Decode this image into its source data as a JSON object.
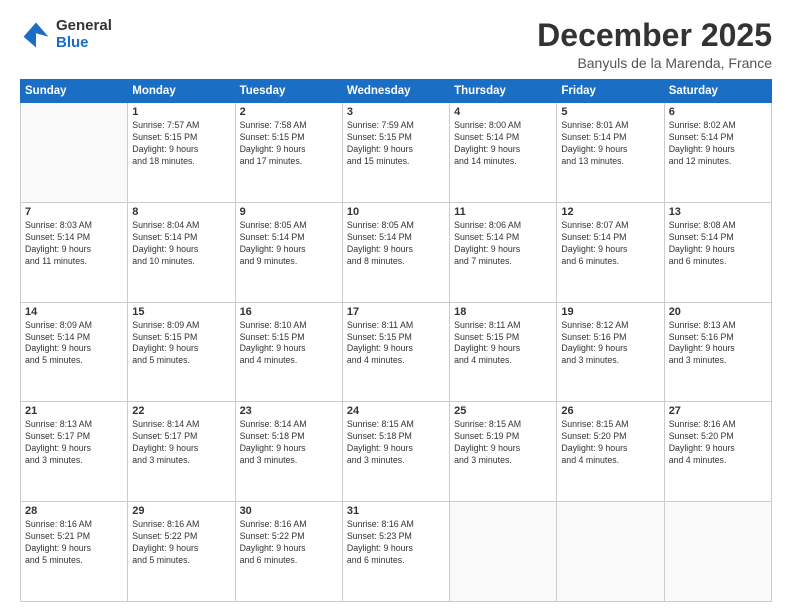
{
  "logo": {
    "general": "General",
    "blue": "Blue"
  },
  "header": {
    "month": "December 2025",
    "location": "Banyuls de la Marenda, France"
  },
  "days_of_week": [
    "Sunday",
    "Monday",
    "Tuesday",
    "Wednesday",
    "Thursday",
    "Friday",
    "Saturday"
  ],
  "weeks": [
    [
      {
        "day": "",
        "sunrise": "",
        "sunset": "",
        "daylight": ""
      },
      {
        "day": "1",
        "sunrise": "Sunrise: 7:57 AM",
        "sunset": "Sunset: 5:15 PM",
        "daylight": "Daylight: 9 hours and 18 minutes."
      },
      {
        "day": "2",
        "sunrise": "Sunrise: 7:58 AM",
        "sunset": "Sunset: 5:15 PM",
        "daylight": "Daylight: 9 hours and 17 minutes."
      },
      {
        "day": "3",
        "sunrise": "Sunrise: 7:59 AM",
        "sunset": "Sunset: 5:15 PM",
        "daylight": "Daylight: 9 hours and 15 minutes."
      },
      {
        "day": "4",
        "sunrise": "Sunrise: 8:00 AM",
        "sunset": "Sunset: 5:14 PM",
        "daylight": "Daylight: 9 hours and 14 minutes."
      },
      {
        "day": "5",
        "sunrise": "Sunrise: 8:01 AM",
        "sunset": "Sunset: 5:14 PM",
        "daylight": "Daylight: 9 hours and 13 minutes."
      },
      {
        "day": "6",
        "sunrise": "Sunrise: 8:02 AM",
        "sunset": "Sunset: 5:14 PM",
        "daylight": "Daylight: 9 hours and 12 minutes."
      }
    ],
    [
      {
        "day": "7",
        "sunrise": "Sunrise: 8:03 AM",
        "sunset": "Sunset: 5:14 PM",
        "daylight": "Daylight: 9 hours and 11 minutes."
      },
      {
        "day": "8",
        "sunrise": "Sunrise: 8:04 AM",
        "sunset": "Sunset: 5:14 PM",
        "daylight": "Daylight: 9 hours and 10 minutes."
      },
      {
        "day": "9",
        "sunrise": "Sunrise: 8:05 AM",
        "sunset": "Sunset: 5:14 PM",
        "daylight": "Daylight: 9 hours and 9 minutes."
      },
      {
        "day": "10",
        "sunrise": "Sunrise: 8:05 AM",
        "sunset": "Sunset: 5:14 PM",
        "daylight": "Daylight: 9 hours and 8 minutes."
      },
      {
        "day": "11",
        "sunrise": "Sunrise: 8:06 AM",
        "sunset": "Sunset: 5:14 PM",
        "daylight": "Daylight: 9 hours and 7 minutes."
      },
      {
        "day": "12",
        "sunrise": "Sunrise: 8:07 AM",
        "sunset": "Sunset: 5:14 PM",
        "daylight": "Daylight: 9 hours and 6 minutes."
      },
      {
        "day": "13",
        "sunrise": "Sunrise: 8:08 AM",
        "sunset": "Sunset: 5:14 PM",
        "daylight": "Daylight: 9 hours and 6 minutes."
      }
    ],
    [
      {
        "day": "14",
        "sunrise": "Sunrise: 8:09 AM",
        "sunset": "Sunset: 5:14 PM",
        "daylight": "Daylight: 9 hours and 5 minutes."
      },
      {
        "day": "15",
        "sunrise": "Sunrise: 8:09 AM",
        "sunset": "Sunset: 5:15 PM",
        "daylight": "Daylight: 9 hours and 5 minutes."
      },
      {
        "day": "16",
        "sunrise": "Sunrise: 8:10 AM",
        "sunset": "Sunset: 5:15 PM",
        "daylight": "Daylight: 9 hours and 4 minutes."
      },
      {
        "day": "17",
        "sunrise": "Sunrise: 8:11 AM",
        "sunset": "Sunset: 5:15 PM",
        "daylight": "Daylight: 9 hours and 4 minutes."
      },
      {
        "day": "18",
        "sunrise": "Sunrise: 8:11 AM",
        "sunset": "Sunset: 5:15 PM",
        "daylight": "Daylight: 9 hours and 4 minutes."
      },
      {
        "day": "19",
        "sunrise": "Sunrise: 8:12 AM",
        "sunset": "Sunset: 5:16 PM",
        "daylight": "Daylight: 9 hours and 3 minutes."
      },
      {
        "day": "20",
        "sunrise": "Sunrise: 8:13 AM",
        "sunset": "Sunset: 5:16 PM",
        "daylight": "Daylight: 9 hours and 3 minutes."
      }
    ],
    [
      {
        "day": "21",
        "sunrise": "Sunrise: 8:13 AM",
        "sunset": "Sunset: 5:17 PM",
        "daylight": "Daylight: 9 hours and 3 minutes."
      },
      {
        "day": "22",
        "sunrise": "Sunrise: 8:14 AM",
        "sunset": "Sunset: 5:17 PM",
        "daylight": "Daylight: 9 hours and 3 minutes."
      },
      {
        "day": "23",
        "sunrise": "Sunrise: 8:14 AM",
        "sunset": "Sunset: 5:18 PM",
        "daylight": "Daylight: 9 hours and 3 minutes."
      },
      {
        "day": "24",
        "sunrise": "Sunrise: 8:15 AM",
        "sunset": "Sunset: 5:18 PM",
        "daylight": "Daylight: 9 hours and 3 minutes."
      },
      {
        "day": "25",
        "sunrise": "Sunrise: 8:15 AM",
        "sunset": "Sunset: 5:19 PM",
        "daylight": "Daylight: 9 hours and 3 minutes."
      },
      {
        "day": "26",
        "sunrise": "Sunrise: 8:15 AM",
        "sunset": "Sunset: 5:20 PM",
        "daylight": "Daylight: 9 hours and 4 minutes."
      },
      {
        "day": "27",
        "sunrise": "Sunrise: 8:16 AM",
        "sunset": "Sunset: 5:20 PM",
        "daylight": "Daylight: 9 hours and 4 minutes."
      }
    ],
    [
      {
        "day": "28",
        "sunrise": "Sunrise: 8:16 AM",
        "sunset": "Sunset: 5:21 PM",
        "daylight": "Daylight: 9 hours and 5 minutes."
      },
      {
        "day": "29",
        "sunrise": "Sunrise: 8:16 AM",
        "sunset": "Sunset: 5:22 PM",
        "daylight": "Daylight: 9 hours and 5 minutes."
      },
      {
        "day": "30",
        "sunrise": "Sunrise: 8:16 AM",
        "sunset": "Sunset: 5:22 PM",
        "daylight": "Daylight: 9 hours and 6 minutes."
      },
      {
        "day": "31",
        "sunrise": "Sunrise: 8:16 AM",
        "sunset": "Sunset: 5:23 PM",
        "daylight": "Daylight: 9 hours and 6 minutes."
      },
      {
        "day": "",
        "sunrise": "",
        "sunset": "",
        "daylight": ""
      },
      {
        "day": "",
        "sunrise": "",
        "sunset": "",
        "daylight": ""
      },
      {
        "day": "",
        "sunrise": "",
        "sunset": "",
        "daylight": ""
      }
    ]
  ]
}
